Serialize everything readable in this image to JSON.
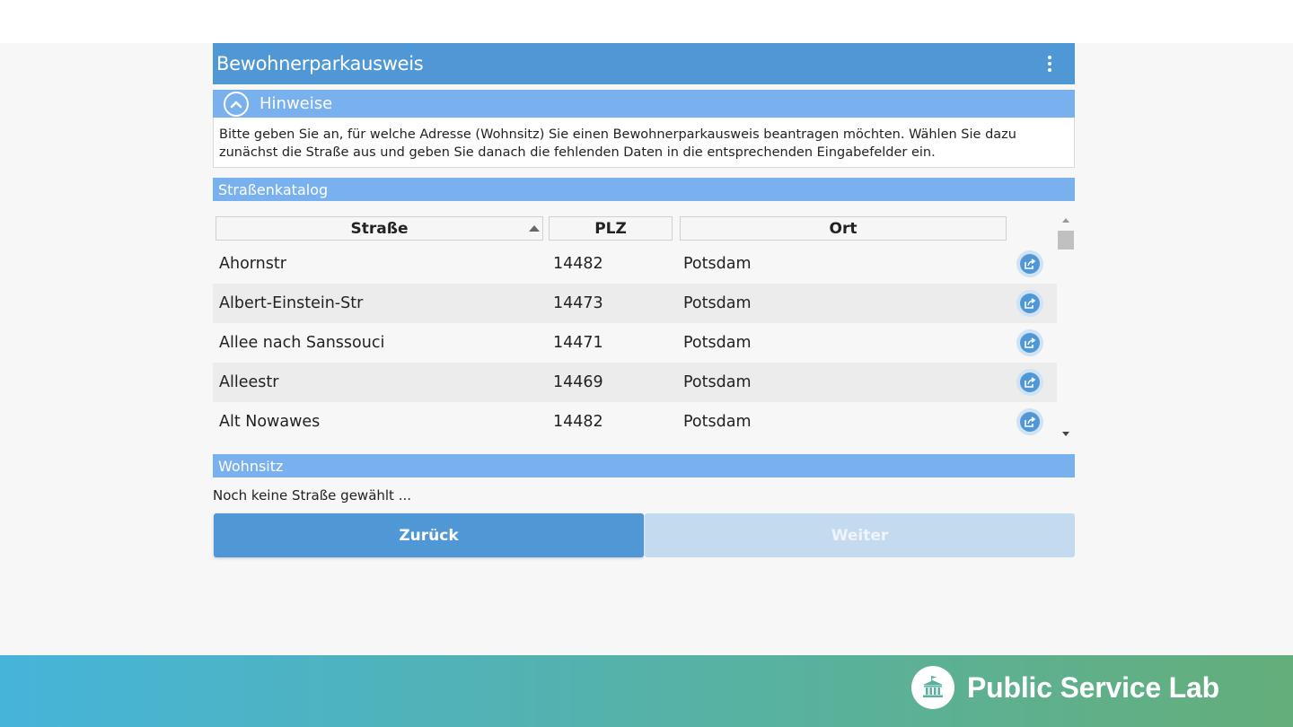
{
  "form": {
    "title": "Bewohnerparkausweis",
    "menu_icon": "kebab-vertical-icon"
  },
  "hinweise": {
    "label": "Hinweise",
    "icon": "chevron-up-icon",
    "text": "Bitte geben Sie an, für welche Adresse (Wohnsitz) Sie einen Bewohnerparkausweis beantragen möchten. Wählen Sie dazu zunächst die Straße aus und geben Sie danach die fehlenden Daten in die entsprechenden Eingabefelder ein."
  },
  "catalog": {
    "label": "Straßenkatalog",
    "columns": [
      "Straße",
      "PLZ",
      "Ort"
    ],
    "sort": {
      "column": "Straße",
      "direction": "ascending"
    },
    "rows": [
      {
        "strasse": "Ahornstr",
        "plz": "14482",
        "ort": "Potsdam"
      },
      {
        "strasse": "Albert-Einstein-Str",
        "plz": "14473",
        "ort": "Potsdam"
      },
      {
        "strasse": "Allee nach Sanssouci",
        "plz": "14471",
        "ort": "Potsdam"
      },
      {
        "strasse": "Alleestr",
        "plz": "14469",
        "ort": "Potsdam"
      },
      {
        "strasse": "Alt Nowawes",
        "plz": "14482",
        "ort": "Potsdam"
      }
    ],
    "row_action_icon": "share-select-icon"
  },
  "wohnsitz": {
    "label": "Wohnsitz",
    "status": "Noch keine Straße gewählt ..."
  },
  "buttons": {
    "back": "Zurück",
    "next": "Weiter"
  },
  "footer": {
    "brand": "Public Service Lab",
    "logo_icon": "government-building-icon"
  },
  "colors": {
    "primary": "#4f97d5",
    "section": "#79b1ee",
    "disabled": "#c4daee",
    "footer_start": "#46b4da",
    "footer_end": "#64ae7a"
  }
}
